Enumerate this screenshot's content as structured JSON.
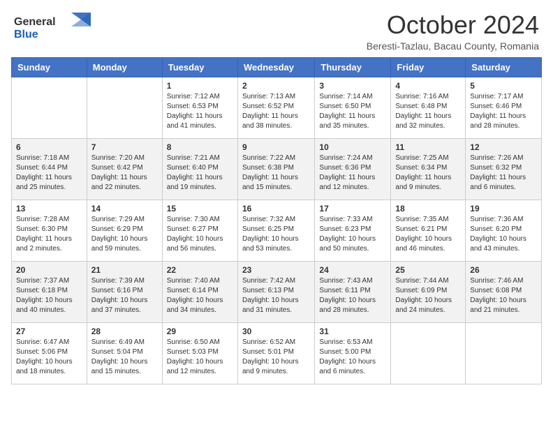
{
  "header": {
    "logo_general": "General",
    "logo_blue": "Blue",
    "month_title": "October 2024",
    "subtitle": "Beresti-Tazlau, Bacau County, Romania"
  },
  "weekdays": [
    "Sunday",
    "Monday",
    "Tuesday",
    "Wednesday",
    "Thursday",
    "Friday",
    "Saturday"
  ],
  "weeks": [
    [
      {
        "day": "",
        "info": ""
      },
      {
        "day": "",
        "info": ""
      },
      {
        "day": "1",
        "info": "Sunrise: 7:12 AM\nSunset: 6:53 PM\nDaylight: 11 hours and 41 minutes."
      },
      {
        "day": "2",
        "info": "Sunrise: 7:13 AM\nSunset: 6:52 PM\nDaylight: 11 hours and 38 minutes."
      },
      {
        "day": "3",
        "info": "Sunrise: 7:14 AM\nSunset: 6:50 PM\nDaylight: 11 hours and 35 minutes."
      },
      {
        "day": "4",
        "info": "Sunrise: 7:16 AM\nSunset: 6:48 PM\nDaylight: 11 hours and 32 minutes."
      },
      {
        "day": "5",
        "info": "Sunrise: 7:17 AM\nSunset: 6:46 PM\nDaylight: 11 hours and 28 minutes."
      }
    ],
    [
      {
        "day": "6",
        "info": "Sunrise: 7:18 AM\nSunset: 6:44 PM\nDaylight: 11 hours and 25 minutes."
      },
      {
        "day": "7",
        "info": "Sunrise: 7:20 AM\nSunset: 6:42 PM\nDaylight: 11 hours and 22 minutes."
      },
      {
        "day": "8",
        "info": "Sunrise: 7:21 AM\nSunset: 6:40 PM\nDaylight: 11 hours and 19 minutes."
      },
      {
        "day": "9",
        "info": "Sunrise: 7:22 AM\nSunset: 6:38 PM\nDaylight: 11 hours and 15 minutes."
      },
      {
        "day": "10",
        "info": "Sunrise: 7:24 AM\nSunset: 6:36 PM\nDaylight: 11 hours and 12 minutes."
      },
      {
        "day": "11",
        "info": "Sunrise: 7:25 AM\nSunset: 6:34 PM\nDaylight: 11 hours and 9 minutes."
      },
      {
        "day": "12",
        "info": "Sunrise: 7:26 AM\nSunset: 6:32 PM\nDaylight: 11 hours and 6 minutes."
      }
    ],
    [
      {
        "day": "13",
        "info": "Sunrise: 7:28 AM\nSunset: 6:30 PM\nDaylight: 11 hours and 2 minutes."
      },
      {
        "day": "14",
        "info": "Sunrise: 7:29 AM\nSunset: 6:29 PM\nDaylight: 10 hours and 59 minutes."
      },
      {
        "day": "15",
        "info": "Sunrise: 7:30 AM\nSunset: 6:27 PM\nDaylight: 10 hours and 56 minutes."
      },
      {
        "day": "16",
        "info": "Sunrise: 7:32 AM\nSunset: 6:25 PM\nDaylight: 10 hours and 53 minutes."
      },
      {
        "day": "17",
        "info": "Sunrise: 7:33 AM\nSunset: 6:23 PM\nDaylight: 10 hours and 50 minutes."
      },
      {
        "day": "18",
        "info": "Sunrise: 7:35 AM\nSunset: 6:21 PM\nDaylight: 10 hours and 46 minutes."
      },
      {
        "day": "19",
        "info": "Sunrise: 7:36 AM\nSunset: 6:20 PM\nDaylight: 10 hours and 43 minutes."
      }
    ],
    [
      {
        "day": "20",
        "info": "Sunrise: 7:37 AM\nSunset: 6:18 PM\nDaylight: 10 hours and 40 minutes."
      },
      {
        "day": "21",
        "info": "Sunrise: 7:39 AM\nSunset: 6:16 PM\nDaylight: 10 hours and 37 minutes."
      },
      {
        "day": "22",
        "info": "Sunrise: 7:40 AM\nSunset: 6:14 PM\nDaylight: 10 hours and 34 minutes."
      },
      {
        "day": "23",
        "info": "Sunrise: 7:42 AM\nSunset: 6:13 PM\nDaylight: 10 hours and 31 minutes."
      },
      {
        "day": "24",
        "info": "Sunrise: 7:43 AM\nSunset: 6:11 PM\nDaylight: 10 hours and 28 minutes."
      },
      {
        "day": "25",
        "info": "Sunrise: 7:44 AM\nSunset: 6:09 PM\nDaylight: 10 hours and 24 minutes."
      },
      {
        "day": "26",
        "info": "Sunrise: 7:46 AM\nSunset: 6:08 PM\nDaylight: 10 hours and 21 minutes."
      }
    ],
    [
      {
        "day": "27",
        "info": "Sunrise: 6:47 AM\nSunset: 5:06 PM\nDaylight: 10 hours and 18 minutes."
      },
      {
        "day": "28",
        "info": "Sunrise: 6:49 AM\nSunset: 5:04 PM\nDaylight: 10 hours and 15 minutes."
      },
      {
        "day": "29",
        "info": "Sunrise: 6:50 AM\nSunset: 5:03 PM\nDaylight: 10 hours and 12 minutes."
      },
      {
        "day": "30",
        "info": "Sunrise: 6:52 AM\nSunset: 5:01 PM\nDaylight: 10 hours and 9 minutes."
      },
      {
        "day": "31",
        "info": "Sunrise: 6:53 AM\nSunset: 5:00 PM\nDaylight: 10 hours and 6 minutes."
      },
      {
        "day": "",
        "info": ""
      },
      {
        "day": "",
        "info": ""
      }
    ]
  ]
}
